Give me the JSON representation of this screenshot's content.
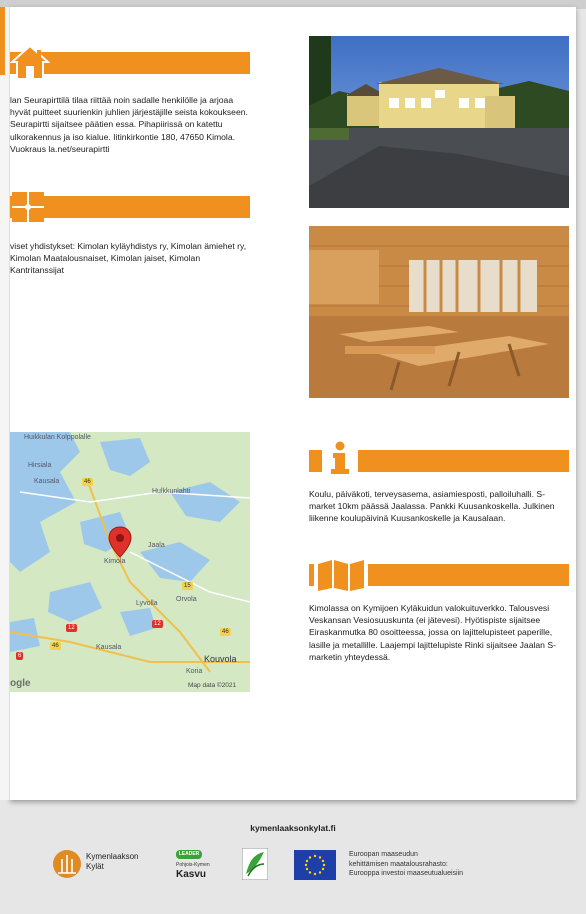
{
  "section_house": {
    "icon": "house-icon",
    "text": "lan Seurapirttilä tilaa riittää noin sadalle henkilölle ja arjoaa hyvät puitteet suurienkin juhlien järjestäjille seista kokoukseen. Seurapirtti sijaitsee päätien essa. Pihapiirissä on katettu ulkorakennus ja iso kialue. Iitinkirkontie 180, 47650 Kimola. Vuokraus la.net/seurapirtti"
  },
  "section_puzzle": {
    "icon": "puzzle-icon",
    "text": "viset yhdistykset: Kimolan kyläyhdistys ry, Kimolan ämiehet ry, Kimolan Maatalousnaiset, Kimolan jaiset, Kimolan Kantritanssijat"
  },
  "section_info": {
    "icon": "info-icon",
    "text": "Koulu, päiväkoti, terveysasema, asiamiesposti, palloiluhalli. S-market 10km päässä Jaalassa. Pankki Kuusankoskella. Julkinen liikenne koulupäivinä Kuusankoskelle ja Kausalaan."
  },
  "section_map": {
    "icon": "map-icon",
    "text": "Kimolassa on Kymijoen Kyläkuidun valokuituverkko. Talousvesi Veskansan Vesiosuuskunta (ei jätevesi). Hyötispiste sijaitsee Eiraskanmutka 80 osoitteessa, jossa on lajittelupisteet paperille, lasille ja metallille. Laajempi lajittelupiste Rinki sijaitsee Jaalan S-marketin yhteydessä."
  },
  "map": {
    "labels": [
      "Huikkulan Kolppolalle",
      "Hirsiala",
      "Kausala",
      "Hulkkunlahti",
      "Kimola",
      "Jaala",
      "Lyvolla",
      "Orvola",
      "Kausala",
      "Kouvola",
      "Koria"
    ],
    "road_badges": [
      "46",
      "46",
      "12",
      "12",
      "46",
      "15",
      "6"
    ],
    "google": "ogle",
    "credit": "Map data ©2021"
  },
  "footer": {
    "url": "kymenlaaksonkylat.fi",
    "logo1": [
      "Kymenlaakson",
      "Kylät"
    ],
    "logo2_top": "LEADER",
    "logo2_mid": "Pohjois-Kymen",
    "logo2_bot": "Kasvu",
    "eu_text": [
      "Euroopan maaseudun",
      "kehittämisen maatalousrahasto:",
      "Eurooppa investoi maaseutualueisiin"
    ]
  },
  "colors": {
    "accent": "#f0901e",
    "page": "#ffffff",
    "background": "#e6e6e6"
  }
}
